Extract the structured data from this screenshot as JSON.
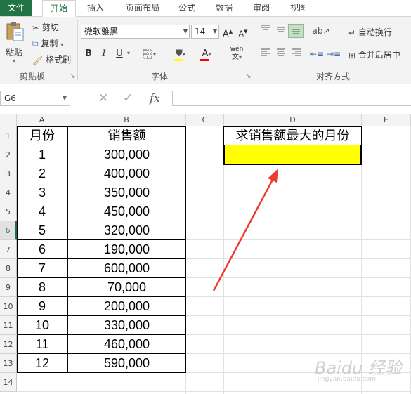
{
  "tabs": [
    "文件",
    "开始",
    "插入",
    "页面布局",
    "公式",
    "数据",
    "审阅",
    "视图"
  ],
  "ribbon": {
    "clipboard": {
      "paste": "粘贴",
      "cut": "剪切",
      "copy": "复制",
      "format_painter": "格式刷",
      "group_label": "剪贴板"
    },
    "font": {
      "font_name": "微软雅黑",
      "font_size": "14",
      "grow": "A",
      "shrink": "A",
      "bold": "B",
      "italic": "I",
      "underline": "U",
      "wen": "wén",
      "group_label": "字体"
    },
    "alignment": {
      "wrap_text": "自动换行",
      "merge_center": "合并后居中",
      "group_label": "对齐方式"
    }
  },
  "formula_bar": {
    "name_box": "G6",
    "fx": "fx",
    "formula": ""
  },
  "sheet": {
    "columns": [
      "A",
      "B",
      "C",
      "D",
      "E"
    ],
    "row_numbers": [
      "1",
      "2",
      "3",
      "4",
      "5",
      "6",
      "7",
      "8",
      "9",
      "10",
      "11",
      "12",
      "13",
      "14"
    ],
    "selected_row": "6",
    "header": {
      "month": "月份",
      "sales": "销售额"
    },
    "rows": [
      {
        "month": "1",
        "sales": "300,000"
      },
      {
        "month": "2",
        "sales": "400,000"
      },
      {
        "month": "3",
        "sales": "350,000"
      },
      {
        "month": "4",
        "sales": "450,000"
      },
      {
        "month": "5",
        "sales": "320,000"
      },
      {
        "month": "6",
        "sales": "190,000"
      },
      {
        "month": "7",
        "sales": "600,000"
      },
      {
        "month": "8",
        "sales": "70,000"
      },
      {
        "month": "9",
        "sales": "200,000"
      },
      {
        "month": "10",
        "sales": "330,000"
      },
      {
        "month": "11",
        "sales": "460,000"
      },
      {
        "month": "12",
        "sales": "590,000"
      }
    ],
    "question": "求销售额最大的月份",
    "answer": ""
  },
  "watermark": {
    "main": "Baidu 经验",
    "sub": "jingyan.baidu.com"
  },
  "colors": {
    "excel_green": "#217346",
    "highlight": "#ffff00",
    "arrow": "#ee3b2f"
  }
}
